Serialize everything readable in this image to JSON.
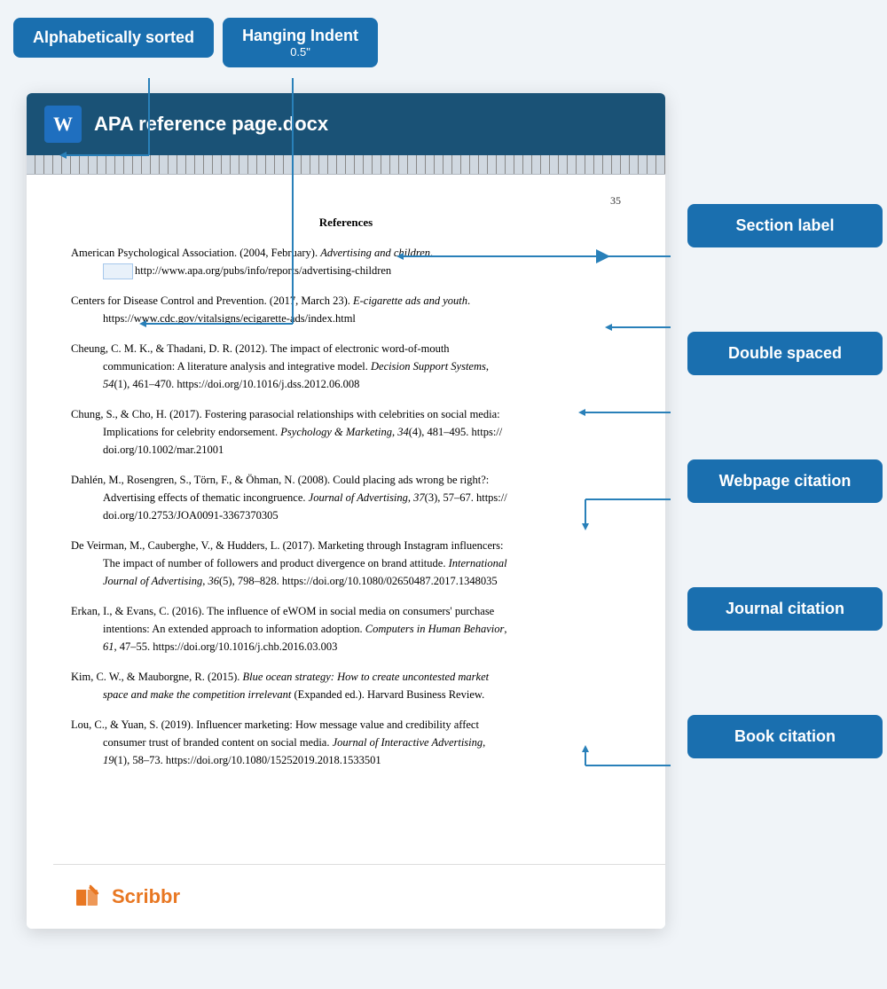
{
  "badges": {
    "alpha_label": "Alphabetically sorted",
    "hanging_label": "Hanging Indent",
    "hanging_sub": "0.5\""
  },
  "doc": {
    "title": "APA reference page.docx",
    "word_icon": "W",
    "page_number": "35",
    "references_heading": "References"
  },
  "right_labels": {
    "section_label": "Section label",
    "double_spaced": "Double spaced",
    "webpage_citation": "Webpage citation",
    "journal_citation": "Journal citation",
    "book_citation": "Book citation"
  },
  "references": [
    {
      "first": "American Psychological Association. (2004, February). ",
      "first_italic": "Advertising and children",
      "first_end": ".",
      "cont": "http://www.apa.org/pubs/info/reports/advertising-children"
    },
    {
      "first": "Centers for Disease Control and Prevention. (2017, March 23). ",
      "first_italic": "E-cigarette ads and youth",
      "first_end": ".",
      "cont": "https://www.cdc.gov/vitalsigns/ecigarette-ads/index.html"
    },
    {
      "first": "Cheung, C. M. K., & Thadani, D. R. (2012). The impact of electronic word-of-mouth",
      "cont1": "communication: A literature analysis and integrative model. ",
      "cont1_italic": "Decision Support Systems",
      "cont1_end": ",",
      "cont2": "54(1), 461–470. https://doi.org/10.1016/j.dss.2012.06.008"
    },
    {
      "first": "Chung, S., & Cho, H. (2017). Fostering parasocial relationships with celebrities on social media:",
      "cont1": "Implications for celebrity endorsement. ",
      "cont1_italic": "Psychology & Marketing",
      "cont1_end": ", 34(4), 481–495. https://",
      "cont2": "doi.org/10.1002/mar.21001"
    },
    {
      "first": "Dahlén, M., Rosengren, S., Törn, F., & Öhman, N. (2008). Could placing ads wrong be right?:",
      "cont1": "Advertising effects of thematic incongruence. ",
      "cont1_italic": "Journal of Advertising",
      "cont1_end": ", 37(3), 57–67. https://",
      "cont2": "doi.org/10.2753/JOA0091-3367370305"
    },
    {
      "first": "De Veirman, M., Cauberghe, V., & Hudders, L. (2017). Marketing through Instagram influencers:",
      "cont1": "The impact of number of followers and product divergence on brand attitude. ",
      "cont1_italic": "International",
      "cont2_italic": "Journal of Advertising",
      "cont2_end": ", 36(5), 798–828. https://doi.org/10.1080/02650487.2017.1348035"
    },
    {
      "first": "Erkan, I., & Evans, C. (2016). The influence of eWOM in social media on consumers' purchase",
      "cont1": "intentions: An extended approach to information adoption. ",
      "cont1_italic": "Computers in Human Behavior",
      "cont1_end": ",",
      "cont2": "61, 47–55. https://doi.org/10.1016/j.chb.2016.03.003"
    },
    {
      "first": "Kim, C. W., & Mauborgne, R. (2015). ",
      "first_italic": "Blue ocean strategy: How to create uncontested market",
      "cont_italic": "space and make the competition irrelevant",
      "cont_end": " (Expanded ed.). Harvard Business Review."
    },
    {
      "first": "Lou, C., & Yuan, S. (2019). Influencer marketing: How message value and credibility affect",
      "cont1": "consumer trust of branded content on social media. ",
      "cont1_italic": "Journal of Interactive Advertising",
      "cont1_end": ",",
      "cont2": "19(1), 58–73. https://doi.org/10.1080/15252019.2018.1533501"
    }
  ],
  "footer": {
    "brand": "Scribbr"
  }
}
